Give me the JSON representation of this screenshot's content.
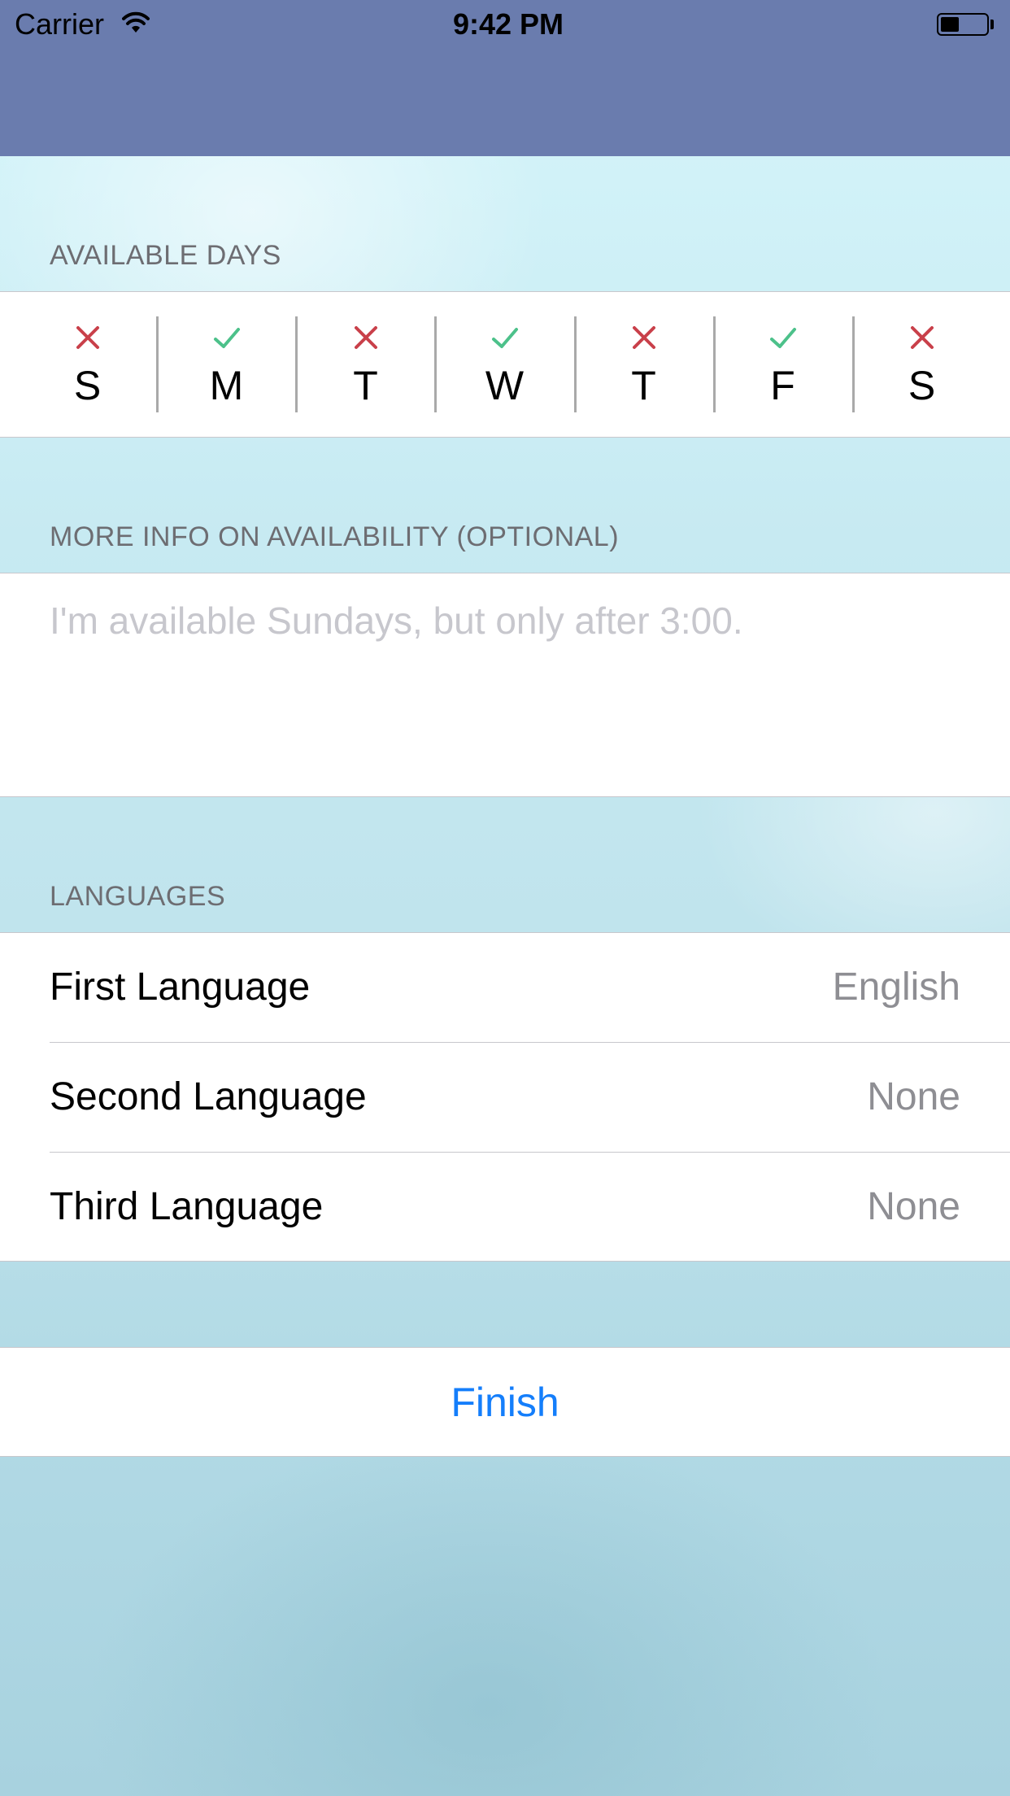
{
  "status_bar": {
    "carrier": "Carrier",
    "time": "9:42 PM",
    "battery_level": 0.4
  },
  "sections": {
    "available_days": {
      "header": "AVAILABLE DAYS",
      "days": [
        {
          "letter": "S",
          "available": false
        },
        {
          "letter": "M",
          "available": true
        },
        {
          "letter": "T",
          "available": false
        },
        {
          "letter": "W",
          "available": true
        },
        {
          "letter": "T",
          "available": false
        },
        {
          "letter": "F",
          "available": true
        },
        {
          "letter": "S",
          "available": false
        }
      ]
    },
    "more_info": {
      "header": "MORE INFO ON AVAILABILITY (OPTIONAL)",
      "value": "",
      "placeholder": "I'm available Sundays, but only after 3:00."
    },
    "languages": {
      "header": "LANGUAGES",
      "rows": [
        {
          "label": "First Language",
          "value": "English"
        },
        {
          "label": "Second Language",
          "value": "None"
        },
        {
          "label": "Third Language",
          "value": "None"
        }
      ]
    }
  },
  "finish_label": "Finish",
  "colors": {
    "nav_bar": "#6a7cae",
    "check": "#4cc18a",
    "cross": "#c9404a",
    "accent": "#147efb"
  },
  "icons": {
    "available": "checkmark-icon",
    "unavailable": "x-mark-icon"
  }
}
